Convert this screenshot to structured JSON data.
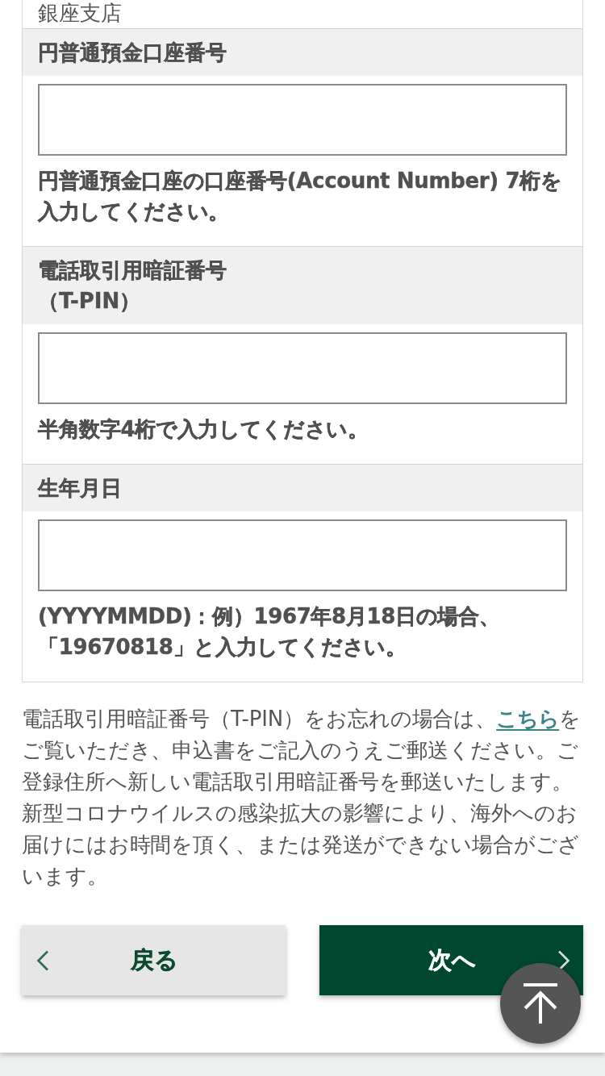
{
  "branch": {
    "name": "銀座支店"
  },
  "fields": [
    {
      "label_lines": [
        "円普通預金口座番号"
      ],
      "help": "円普通預金口座の口座番号(Account Number) 7桁を入力してください。"
    },
    {
      "label_lines": [
        "電話取引用暗証番号",
        "（T-PIN）"
      ],
      "help": "半角数字4桁で入力してください。"
    },
    {
      "label_lines": [
        "生年月日"
      ],
      "help": "(YYYYMMDD)：例）1967年8月18日の場合、「19670818」と入力してください。"
    }
  ],
  "notice": {
    "text": "電話取引用暗証番号（T-PIN）をお忘れの場合は、",
    "link": "こちら",
    "text_after": "をご覧いただき、申込書をご記入のうえご郵送ください。ご登録住所へ新しい電話取引用暗証番号を郵送いたします。新型コロナウイルスの感染拡大の影響により、海外へのお届けにはお時間を頂く、または発送ができない場合がございます。"
  },
  "buttons": [
    {
      "kind": "back",
      "label": "戻る"
    },
    {
      "kind": "next",
      "label": "次へ"
    }
  ]
}
